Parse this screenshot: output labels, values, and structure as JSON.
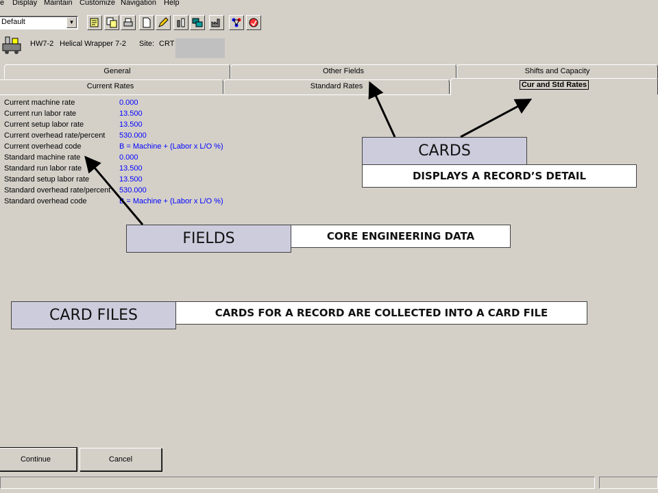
{
  "menubar": {
    "items": [
      "e",
      "Display",
      "Maintain",
      "Customize",
      "Navigation",
      "Help"
    ]
  },
  "toolbar": {
    "combo_value": "Default",
    "buttons": [
      "notes-icon",
      "copy-icon",
      "print-icon",
      "new-document-icon",
      "edit-icon",
      "tools-icon",
      "windows-icon",
      "factory-icon",
      "network-icon",
      "help-icon"
    ]
  },
  "header": {
    "resource_id": "HW7-2",
    "resource_name": "Helical Wrapper 7-2",
    "site_label": "Site:",
    "site_value": "CRT"
  },
  "tabs": {
    "row1": [
      "General",
      "Other Fields",
      "Shifts and Capacity"
    ],
    "row2": [
      "Current Rates",
      "Standard Rates",
      "Cur and Std Rates"
    ]
  },
  "fields": [
    {
      "label": "Current machine rate",
      "value": "0.000"
    },
    {
      "label": "Current run labor rate",
      "value": "13.500"
    },
    {
      "label": "Current setup labor rate",
      "value": "13.500"
    },
    {
      "label": "Current overhead rate/percent",
      "value": "530.000"
    },
    {
      "label": "Current overhead code",
      "value": "B = Machine + (Labor x L/O %)"
    },
    {
      "label": "Standard machine rate",
      "value": "0.000"
    },
    {
      "label": "Standard run labor rate",
      "value": "13.500"
    },
    {
      "label": "Standard setup labor rate",
      "value": "13.500"
    },
    {
      "label": "Standard overhead rate/percent",
      "value": "530.000"
    },
    {
      "label": "Standard overhead code",
      "value": "B = Machine + (Labor x L/O %)"
    }
  ],
  "callouts": {
    "cards": {
      "title": "CARDS",
      "desc": "DISPLAYS A RECORD’S DETAIL"
    },
    "fields": {
      "title": "FIELDS",
      "desc": "CORE ENGINEERING DATA"
    },
    "card_files": {
      "title": "CARD FILES",
      "desc": "CARDS FOR A RECORD ARE COLLECTED INTO A CARD FILE"
    }
  },
  "buttons": {
    "continue": "Continue",
    "cancel": "Cancel"
  },
  "colors": {
    "background": "#d4d0c8",
    "field_value": "#0000ff",
    "callout_fill": "#ccccdd"
  }
}
